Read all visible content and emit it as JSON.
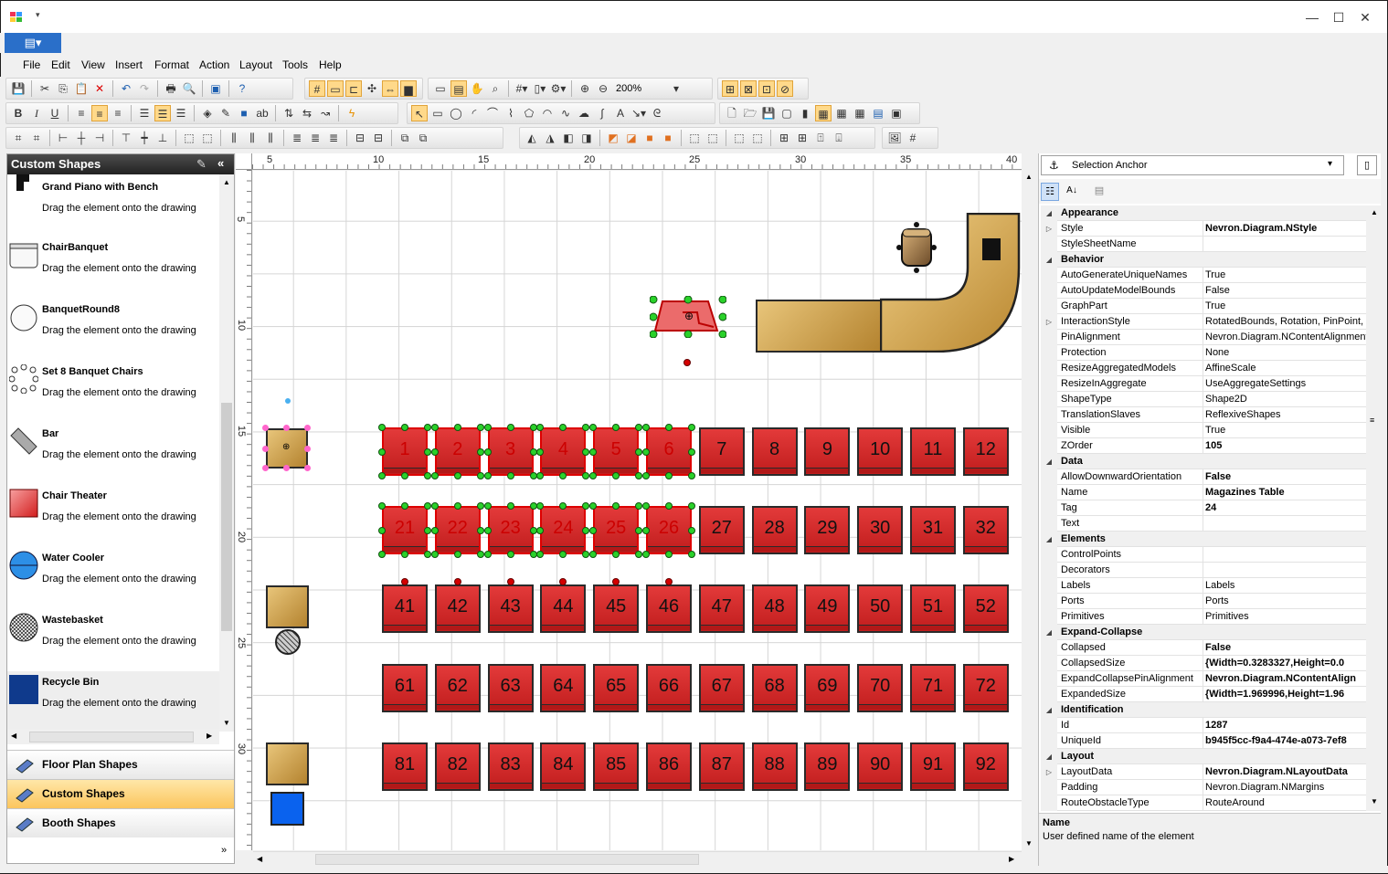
{
  "window": {
    "minimize": "—",
    "maximize": "☐",
    "close": "✕"
  },
  "menu": [
    "File",
    "Edit",
    "View",
    "Insert",
    "Format",
    "Action",
    "Layout",
    "Tools",
    "Help"
  ],
  "toolbar": {
    "zoom": "200%"
  },
  "left_panel": {
    "title": "Custom Shapes",
    "shapes": [
      {
        "name": "Grand Piano with Bench",
        "desc": "Drag the element onto the drawing"
      },
      {
        "name": "ChairBanquet",
        "desc": "Drag the element onto the drawing"
      },
      {
        "name": "BanquetRound8",
        "desc": "Drag the element onto the drawing"
      },
      {
        "name": "Set 8 Banquet Chairs",
        "desc": "Drag the element onto the drawing"
      },
      {
        "name": "Bar",
        "desc": "Drag the element onto the drawing"
      },
      {
        "name": "Chair Theater",
        "desc": "Drag the element onto the drawing"
      },
      {
        "name": "Water Cooler",
        "desc": "Drag the element onto the drawing"
      },
      {
        "name": "Wastebasket",
        "desc": "Drag the element onto the drawing"
      },
      {
        "name": "Recycle Bin",
        "desc": "Drag the element onto the drawing"
      }
    ],
    "categories": [
      "Floor Plan Shapes",
      "Custom Shapes",
      "Booth Shapes"
    ]
  },
  "rulers": {
    "horizontal": [
      "5",
      "10",
      "15",
      "20",
      "25",
      "30",
      "35",
      "40"
    ],
    "vertical": [
      "5",
      "10",
      "15",
      "20",
      "25",
      "30"
    ]
  },
  "seats": {
    "row1": [
      "1",
      "2",
      "3",
      "4",
      "5",
      "6",
      "7",
      "8",
      "9",
      "10",
      "11",
      "12"
    ],
    "row2": [
      "21",
      "22",
      "23",
      "24",
      "25",
      "26",
      "27",
      "28",
      "29",
      "30",
      "31",
      "32"
    ],
    "row3": [
      "41",
      "42",
      "43",
      "44",
      "45",
      "46",
      "47",
      "48",
      "49",
      "50",
      "51",
      "52"
    ],
    "row4": [
      "61",
      "62",
      "63",
      "64",
      "65",
      "66",
      "67",
      "68",
      "69",
      "70",
      "71",
      "72"
    ],
    "row5": [
      "81",
      "82",
      "83",
      "84",
      "85",
      "86",
      "87",
      "88",
      "89",
      "90",
      "91",
      "92"
    ]
  },
  "properties": {
    "combo": "Selection Anchor",
    "rows": [
      {
        "type": "cat",
        "name": "Appearance"
      },
      {
        "name": "Style",
        "value": "Nevron.Diagram.NStyle",
        "bold": true,
        "expand": true
      },
      {
        "name": "StyleSheetName",
        "value": ""
      },
      {
        "type": "cat",
        "name": "Behavior"
      },
      {
        "name": "AutoGenerateUniqueNames",
        "value": "True"
      },
      {
        "name": "AutoUpdateModelBounds",
        "value": "False"
      },
      {
        "name": "GraphPart",
        "value": "True"
      },
      {
        "name": "InteractionStyle",
        "value": "RotatedBounds, Rotation, PinPoint, S",
        "expand": true
      },
      {
        "name": "PinAlignment",
        "value": "Nevron.Diagram.NContentAlignment"
      },
      {
        "name": "Protection",
        "value": "None"
      },
      {
        "name": "ResizeAggregatedModels",
        "value": "AffineScale"
      },
      {
        "name": "ResizeInAggregate",
        "value": "UseAggregateSettings"
      },
      {
        "name": "ShapeType",
        "value": "Shape2D"
      },
      {
        "name": "TranslationSlaves",
        "value": "ReflexiveShapes"
      },
      {
        "name": "Visible",
        "value": "True"
      },
      {
        "name": "ZOrder",
        "value": "105",
        "bold": true
      },
      {
        "type": "cat",
        "name": "Data"
      },
      {
        "name": "AllowDownwardOrientation",
        "value": "False",
        "bold": true
      },
      {
        "name": "Name",
        "value": "Magazines Table",
        "bold": true
      },
      {
        "name": "Tag",
        "value": "24",
        "bold": true
      },
      {
        "name": "Text",
        "value": ""
      },
      {
        "type": "cat",
        "name": "Elements"
      },
      {
        "name": "ControlPoints",
        "value": ""
      },
      {
        "name": "Decorators",
        "value": ""
      },
      {
        "name": "Labels",
        "value": "Labels"
      },
      {
        "name": "Ports",
        "value": "Ports"
      },
      {
        "name": "Primitives",
        "value": "Primitives"
      },
      {
        "type": "cat",
        "name": "Expand-Collapse"
      },
      {
        "name": "Collapsed",
        "value": "False",
        "bold": true
      },
      {
        "name": "CollapsedSize",
        "value": "{Width=0.3283327,Height=0.0",
        "bold": true
      },
      {
        "name": "ExpandCollapsePinAlignment",
        "value": "Nevron.Diagram.NContentAlign",
        "bold": true
      },
      {
        "name": "ExpandedSize",
        "value": "{Width=1.969996,Height=1.96",
        "bold": true
      },
      {
        "type": "cat",
        "name": "Identification"
      },
      {
        "name": "Id",
        "value": "1287",
        "bold": true
      },
      {
        "name": "UniqueId",
        "value": "b945f5cc-f9a4-474e-a073-7ef8",
        "bold": true
      },
      {
        "type": "cat",
        "name": "Layout"
      },
      {
        "name": "LayoutData",
        "value": "Nevron.Diagram.NLayoutData",
        "bold": true,
        "expand": true
      },
      {
        "name": "Padding",
        "value": "Nevron.Diagram.NMargins"
      },
      {
        "name": "RouteObstacleType",
        "value": "RouteAround"
      }
    ],
    "description": {
      "title": "Name",
      "text": "User defined name of the element"
    }
  }
}
